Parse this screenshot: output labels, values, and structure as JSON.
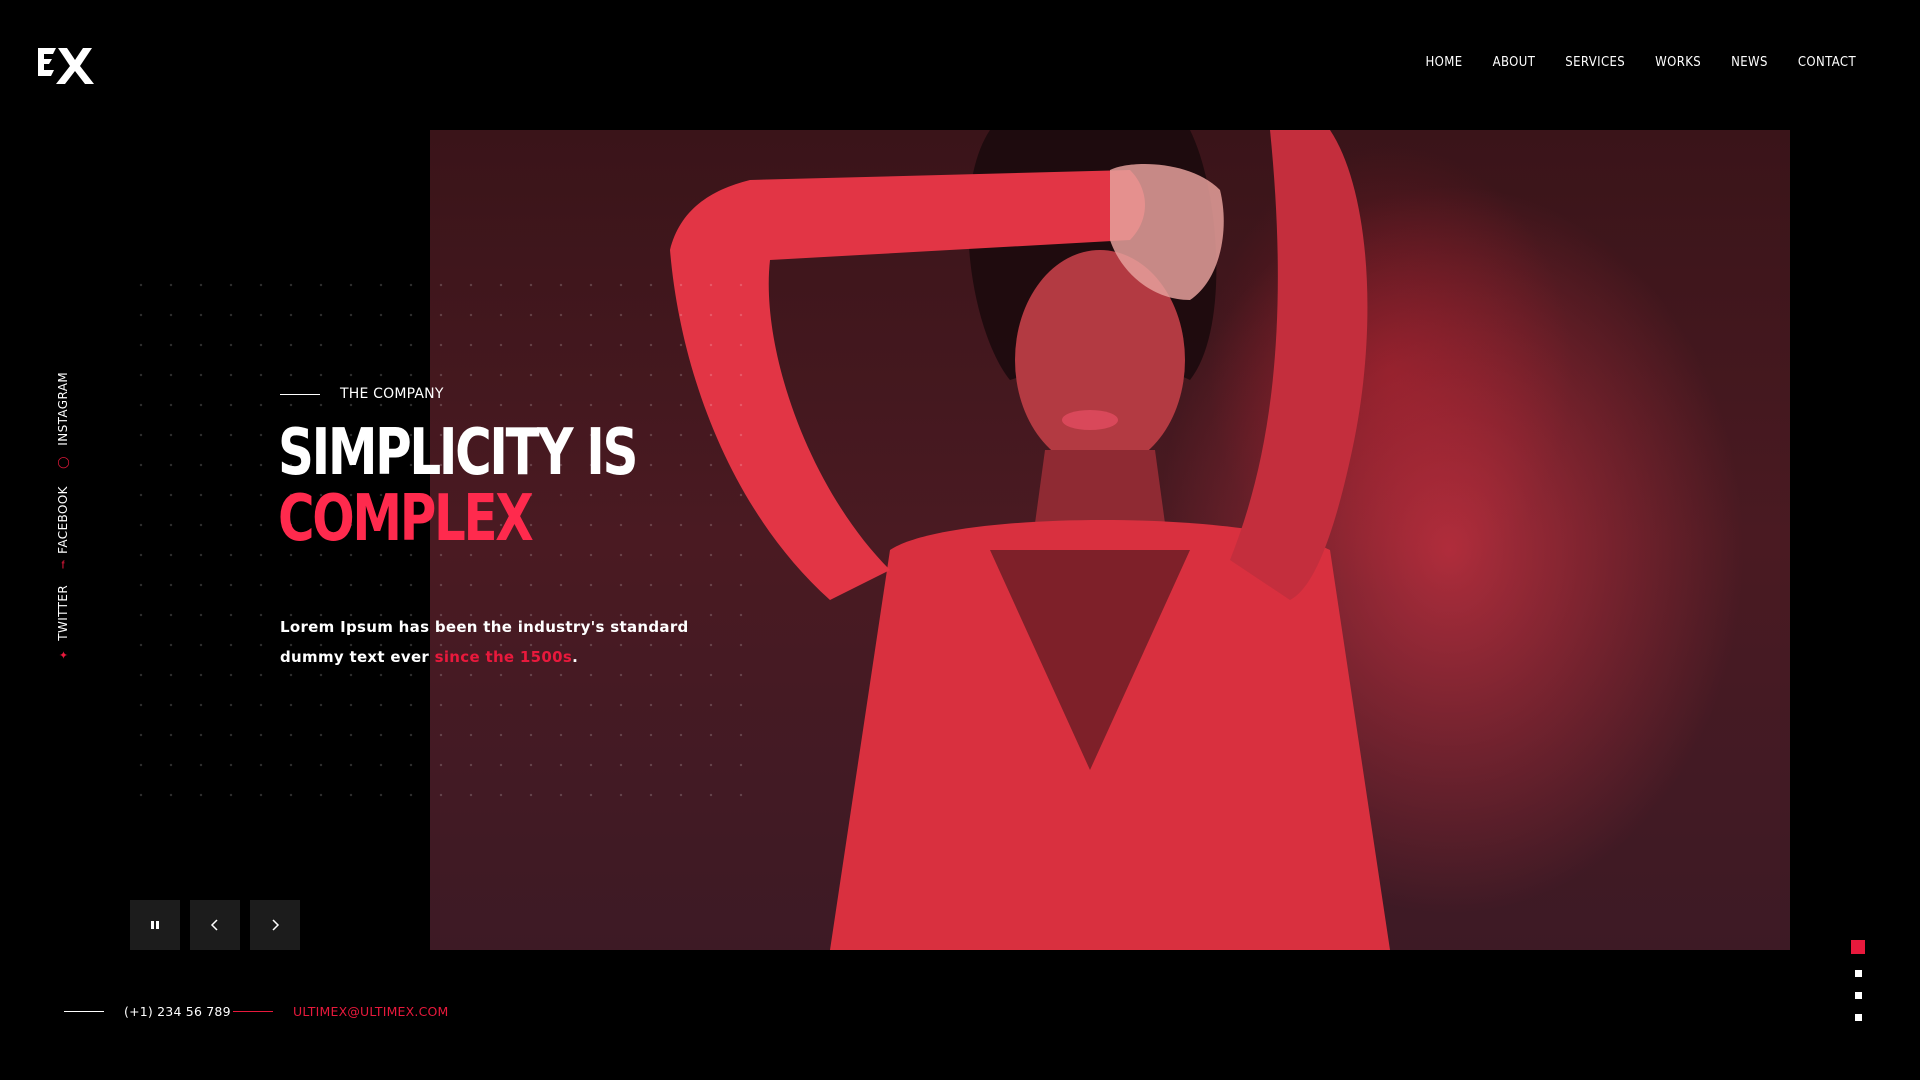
{
  "brand": {
    "logo_icon": "ex-logo-icon",
    "accent_color": "#e8193c"
  },
  "nav": {
    "items": [
      {
        "label": "HOME"
      },
      {
        "label": "ABOUT"
      },
      {
        "label": "SERVICES"
      },
      {
        "label": "WORKS"
      },
      {
        "label": "NEWS"
      },
      {
        "label": "CONTACT"
      }
    ]
  },
  "social": {
    "items": [
      {
        "label": "TWITTER",
        "icon": "twitter-icon"
      },
      {
        "label": "FACEBOOK",
        "icon": "facebook-icon"
      },
      {
        "label": "INSTAGRAM",
        "icon": "instagram-icon"
      }
    ]
  },
  "hero": {
    "eyebrow": "THE COMPANY",
    "headline_line1": "SIMPLICITY IS",
    "headline_line2": "COMPLEX",
    "description_main": "Lorem Ipsum has been the industry's standard dummy text ever ",
    "description_accent": "since the 1500s",
    "description_end": "."
  },
  "controls": {
    "pause_icon": "pause-icon",
    "prev_icon": "chevron-left-icon",
    "next_icon": "chevron-right-icon"
  },
  "contact": {
    "phone": "(+1) 234 56 789",
    "email": "ULTIMEX@ULTIMEX.COM"
  },
  "pager": {
    "total": 4,
    "active_index": 0
  }
}
